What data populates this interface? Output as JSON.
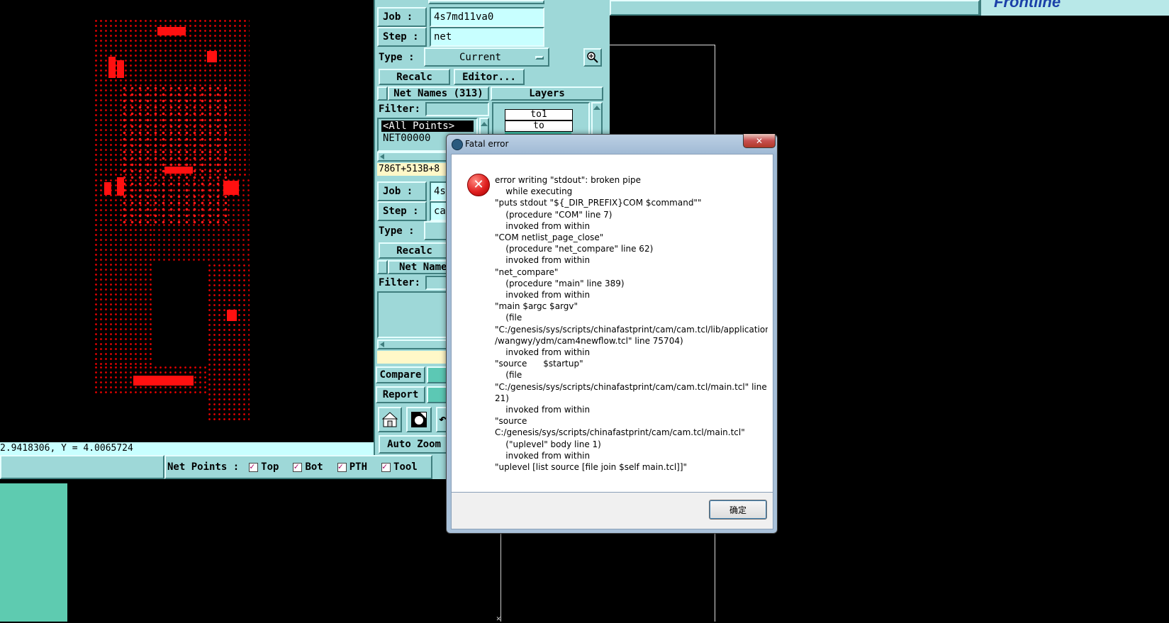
{
  "status_bar": {
    "coord": "2.9418306, Y = 4.0065724"
  },
  "net_points": {
    "label": "Net Points :",
    "options": [
      {
        "label": "Top",
        "checked": true
      },
      {
        "label": "Bot",
        "checked": true
      },
      {
        "label": "PTH",
        "checked": true
      },
      {
        "label": "Tool",
        "checked": true
      }
    ]
  },
  "logo": {
    "text": "Frontline"
  },
  "panel1": {
    "job_label": "Job  :",
    "job_value": "4s7md11va0",
    "step_label": "Step :",
    "step_value": "net",
    "type_label": "Type :",
    "type_value": "Current",
    "recalc": "Recalc",
    "editor": "Editor...",
    "net_names_header": "Net Names (313)",
    "layers_header": "Layers",
    "filter_label": "Filter:",
    "net_list": [
      "<All Points>",
      "NET00000"
    ],
    "layers": [
      "to1",
      "to"
    ],
    "summary": "786T+513B+8"
  },
  "panel2": {
    "job_label": "Job  :",
    "job_value": "4s",
    "step_label": "Step :",
    "step_value": "ca",
    "type_label": "Type :",
    "recalc": "Recalc",
    "net_names_header": "Net Name",
    "filter_label": "Filter:"
  },
  "bottom_buttons": {
    "compare": "Compare",
    "report": "Report",
    "auto_zoom": "Auto Zoom"
  },
  "dialog": {
    "title": "Fatal error",
    "message_lines": [
      "error writing \"stdout\": broken pipe",
      "    while executing",
      "\"puts stdout \"${_DIR_PREFIX}COM $command\"\"",
      "    (procedure \"COM\" line 7)",
      "    invoked from within",
      "\"COM netlist_page_close\"",
      "    (procedure \"net_compare\" line 62)",
      "    invoked from within",
      "\"net_compare\"",
      "    (procedure \"main\" line 389)",
      "    invoked from within",
      "\"main $argc $argv\"",
      "    (file",
      "\"C:/genesis/sys/scripts/chinafastprint/cam/cam.tcl/lib/application",
      "/wangwy/ydm/cam4newflow.tcl\" line 75704)",
      "    invoked from within",
      "\"source      $startup\"",
      "    (file",
      "\"C:/genesis/sys/scripts/chinafastprint/cam/cam.tcl/main.tcl\" line",
      "21)",
      "    invoked from within",
      "\"source",
      "C:/genesis/sys/scripts/chinafastprint/cam/cam.tcl/main.tcl\"",
      "    (\"uplevel\" body line 1)",
      "    invoked from within",
      "\"uplevel [list source [file join $self main.tcl]]\""
    ],
    "ok_button": "确定",
    "close_glyph": "✕"
  },
  "colors": {
    "teal": "#9ed8d8",
    "teal_dark": "#5cc8b4",
    "pcb_red": "#ff1010",
    "field": "#c8ffff"
  }
}
